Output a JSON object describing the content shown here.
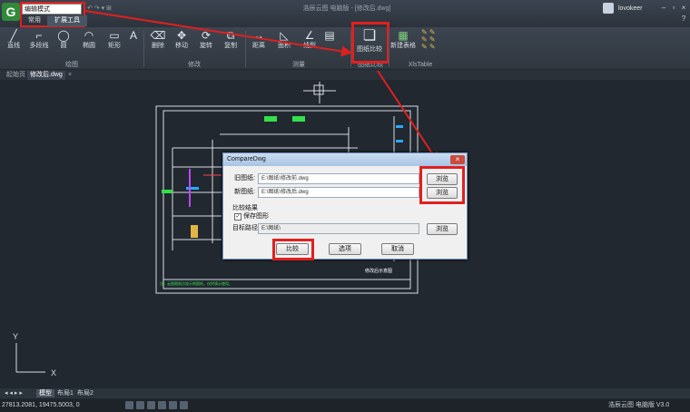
{
  "titlebar": {
    "logo": "G",
    "mode_select": "编辑模式",
    "quick_access": "↶ ↷ ▾ ⊞",
    "doc_title": "浩辰云图 电脑版 - [修改后.dwg]",
    "username": "lovokeer",
    "min": "–",
    "restore": "▫",
    "close": "×",
    "help": "?"
  },
  "ribbon_tabs": {
    "common": "常用",
    "extension": "扩展工具"
  },
  "ribbon": {
    "draw": [
      {
        "icon": "╱",
        "label": "直线"
      },
      {
        "icon": "⌐",
        "label": "多段线"
      },
      {
        "icon": "◯",
        "label": "圆"
      },
      {
        "icon": "◠",
        "label": "椭圆"
      },
      {
        "icon": "▭",
        "label": "矩形"
      },
      {
        "icon": "A",
        "label": ""
      }
    ],
    "modify": [
      {
        "icon": "⌫",
        "label": "删除"
      },
      {
        "icon": "✥",
        "label": "移动"
      },
      {
        "icon": "⟳",
        "label": "旋转"
      },
      {
        "icon": "⧉",
        "label": "复制"
      }
    ],
    "measure": [
      {
        "icon": "↔",
        "label": "距离"
      },
      {
        "icon": "◺",
        "label": "面积"
      },
      {
        "icon": "∠",
        "label": "线型"
      },
      {
        "icon": "▤",
        "label": ""
      }
    ],
    "compare": {
      "icon": "❏",
      "label": "图纸比较"
    },
    "xls": [
      {
        "icon": "▦",
        "label": "新建表格"
      }
    ],
    "groups": {
      "draw": "绘图",
      "modify": "修改",
      "measure": "测量",
      "compare": "图纸比较",
      "xls": "XlsTable"
    }
  },
  "doc_tabs": {
    "start": "起始页",
    "active": "修改后.dwg",
    "close": "×"
  },
  "layout_tabs": {
    "nav": "◂ ◂ ▸ ▸",
    "model": "模型",
    "layout1": "布局1",
    "layout2": "布局2"
  },
  "status": {
    "coords": "27813.2081, 19475.5003, 0",
    "product": "浩辰云图 电脑版 V3.0"
  },
  "canvas": {
    "ucs_y": "Y",
    "ucs_x": "X",
    "note": "注：云图图纸比较示例图纸，仅供演示使用。",
    "title_text": "修改后示意图"
  },
  "dialog": {
    "title": "CompareDwg",
    "close": "×",
    "old_label": "旧图纸:",
    "old_path": "E:\\图纸\\修改前.dwg",
    "new_label": "新图纸:",
    "new_path": "E:\\图纸\\修改后.dwg",
    "browse": "浏览",
    "result_label": "比较结果",
    "save_check": "✓",
    "save_label": "保存图形",
    "target_label": "目标路径",
    "target_path": "E:\\图纸\\",
    "compare_btn": "比较",
    "options_btn": "选项",
    "cancel_btn": "取消"
  },
  "colors": {
    "highlight": "#e0201f",
    "cad_bg": "#212830",
    "ribbon": "#353d47"
  }
}
